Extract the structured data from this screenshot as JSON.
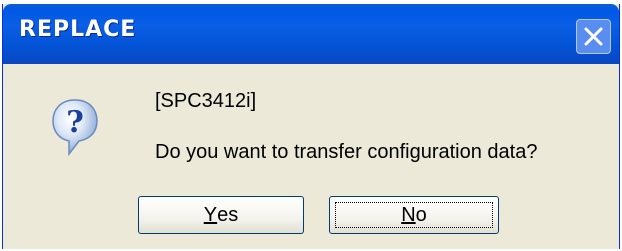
{
  "dialog": {
    "title": "REPLACE",
    "close_icon": "close-icon",
    "message_icon": "question-icon",
    "message_line1": "[SPC3412i]",
    "message_line2": "Do you want to transfer configuration data?"
  },
  "buttons": {
    "yes_accel": "Y",
    "yes_rest": "es",
    "no_accel": "N",
    "no_rest": "o"
  },
  "colors": {
    "titlebar": "#0058e6",
    "dialog_bg": "#ece9d8"
  }
}
